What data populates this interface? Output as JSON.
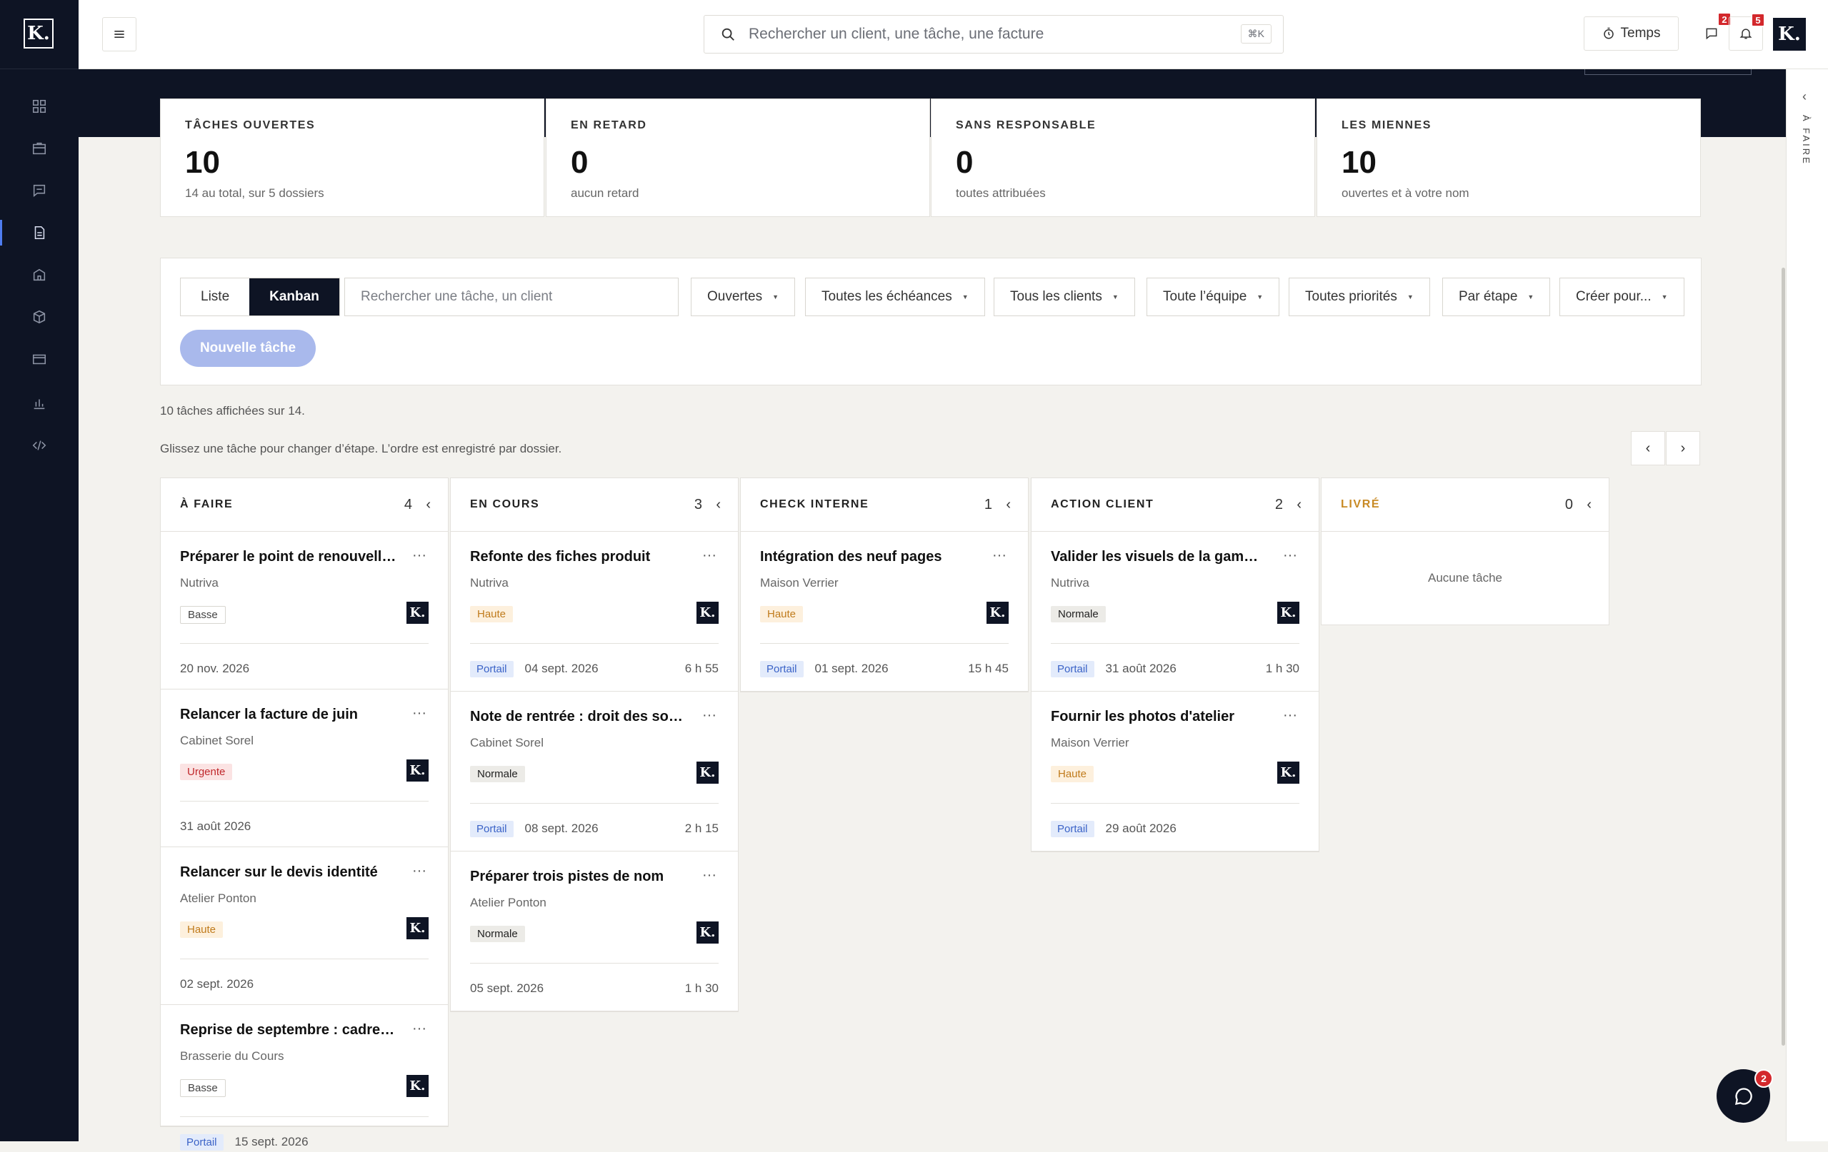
{
  "app": {
    "logo_letter": "K."
  },
  "search": {
    "placeholder": "Rechercher un client, une tâche, une facture",
    "shortcut": "⌘K"
  },
  "topbar": {
    "temps_label": "Temps",
    "messages_badge": "2",
    "notifications_badge": "5"
  },
  "right_panel": {
    "label": "À FAIRE"
  },
  "stats": [
    {
      "label": "TÂCHES OUVERTES",
      "value": "10",
      "sub": "14 au total, sur 5 dossiers"
    },
    {
      "label": "EN RETARD",
      "value": "0",
      "sub": "aucun retard"
    },
    {
      "label": "SANS RESPONSABLE",
      "value": "0",
      "sub": "toutes attribuées"
    },
    {
      "label": "LES MIENNES",
      "value": "10",
      "sub": "ouvertes et à votre nom"
    }
  ],
  "filters": {
    "view_liste": "Liste",
    "view_kanban": "Kanban",
    "search_placeholder": "Rechercher une tâche, un client",
    "status": "Ouvertes",
    "due": "Toutes les échéances",
    "clients": "Tous les clients",
    "team": "Toute l’équipe",
    "priority": "Toutes priorités",
    "group": "Par étape",
    "created": "Créer pour...",
    "new_task": "Nouvelle tâche"
  },
  "info": {
    "count_text": "10 tâches affichées sur 14.",
    "hint_text": "Glissez une tâche pour changer d’étape. L’ordre est enregistré par dossier."
  },
  "columns": [
    {
      "title": "À FAIRE",
      "count": "4",
      "cards": [
        {
          "title": "Préparer le point de renouvellement",
          "client": "Nutriva",
          "priority": "Basse",
          "ptype": "basse",
          "date": "20 nov. 2026"
        },
        {
          "title": "Relancer la facture de juin",
          "client": "Cabinet Sorel",
          "priority": "Urgente",
          "ptype": "urgente",
          "date": "31 août 2026"
        },
        {
          "title": "Relancer sur le devis identité",
          "client": "Atelier Ponton",
          "priority": "Haute",
          "ptype": "haute",
          "date": "02 sept. 2026"
        },
        {
          "title": "Reprise de septembre : cadrer les priorités",
          "client": "Brasserie du Cours",
          "priority": "Basse",
          "ptype": "basse",
          "portail": "Portail",
          "date": "15 sept. 2026"
        }
      ]
    },
    {
      "title": "EN COURS",
      "count": "3",
      "cards": [
        {
          "title": "Refonte des fiches produit",
          "client": "Nutriva",
          "priority": "Haute",
          "ptype": "haute",
          "portail": "Portail",
          "date": "04 sept. 2026",
          "duration": "6 h 55"
        },
        {
          "title": "Note de rentrée : droit des sociétés",
          "client": "Cabinet Sorel",
          "priority": "Normale",
          "ptype": "normale",
          "portail": "Portail",
          "date": "08 sept. 2026",
          "duration": "2 h 15"
        },
        {
          "title": "Préparer trois pistes de nom",
          "client": "Atelier Ponton",
          "priority": "Normale",
          "ptype": "normale",
          "date": "05 sept. 2026",
          "duration": "1 h 30"
        }
      ]
    },
    {
      "title": "CHECK INTERNE",
      "count": "1",
      "cards": [
        {
          "title": "Intégration des neuf pages",
          "client": "Maison Verrier",
          "priority": "Haute",
          "ptype": "haute",
          "portail": "Portail",
          "date": "01 sept. 2026",
          "duration": "15 h 45"
        }
      ]
    },
    {
      "title": "ACTION CLIENT",
      "count": "2",
      "cards": [
        {
          "title": "Valider les visuels de la gamme bio",
          "client": "Nutriva",
          "priority": "Normale",
          "ptype": "normale",
          "portail": "Portail",
          "date": "31 août 2026",
          "duration": "1 h 30"
        },
        {
          "title": "Fournir les photos d'atelier",
          "client": "Maison Verrier",
          "priority": "Haute",
          "ptype": "haute",
          "portail": "Portail",
          "date": "29 août 2026"
        }
      ]
    },
    {
      "title": "LIVRÉ",
      "count": "0",
      "empty": "Aucune tâche",
      "cards": []
    }
  ],
  "chat": {
    "badge": "2"
  }
}
